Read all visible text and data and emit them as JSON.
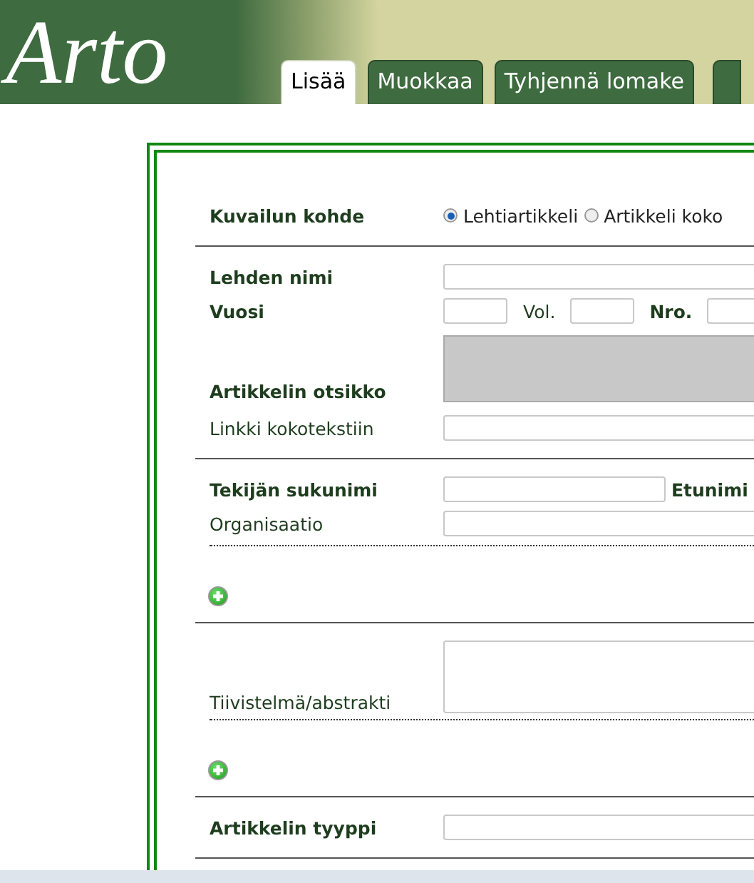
{
  "header": {
    "logo": "Arto"
  },
  "tabs": [
    {
      "label": "Lisää",
      "selected": true
    },
    {
      "label": "Muokkaa",
      "selected": false
    },
    {
      "label": "Tyhjennä lomake",
      "selected": false
    }
  ],
  "form": {
    "items": [
      {
        "kind": "radio",
        "label": "Kuvailun kohde",
        "bold": true,
        "options": [
          {
            "label": "Lehtiartikkeli",
            "selected": true
          },
          {
            "label": "Artikkeli koko",
            "selected": false
          }
        ]
      },
      {
        "kind": "rule"
      },
      {
        "kind": "field",
        "label": "Lehden nimi",
        "bold": true
      },
      {
        "kind": "numbers",
        "label": "Vuosi",
        "bold": true,
        "parts": [
          {
            "label": "Vol.",
            "bold": false
          },
          {
            "label": "Nro.",
            "bold": true
          }
        ]
      },
      {
        "kind": "title",
        "label": "Artikkelin otsikko",
        "bold": true,
        "disabled": true
      },
      {
        "kind": "field",
        "label": "Linkki kokotekstiin",
        "bold": false
      },
      {
        "kind": "rule"
      },
      {
        "kind": "name",
        "label": "Tekijän sukunimi",
        "bold": true,
        "second_label": "Etunimi"
      },
      {
        "kind": "field",
        "label": "Organisaatio",
        "bold": false
      },
      {
        "kind": "dotted"
      },
      {
        "kind": "add"
      },
      {
        "kind": "rule"
      },
      {
        "kind": "textarea",
        "label": "Tiivistelmä/abstrakti",
        "bold": false
      },
      {
        "kind": "dotted"
      },
      {
        "kind": "add"
      },
      {
        "kind": "rule"
      },
      {
        "kind": "field",
        "label": "Artikkelin tyyppi",
        "bold": true
      },
      {
        "kind": "rule"
      }
    ]
  }
}
